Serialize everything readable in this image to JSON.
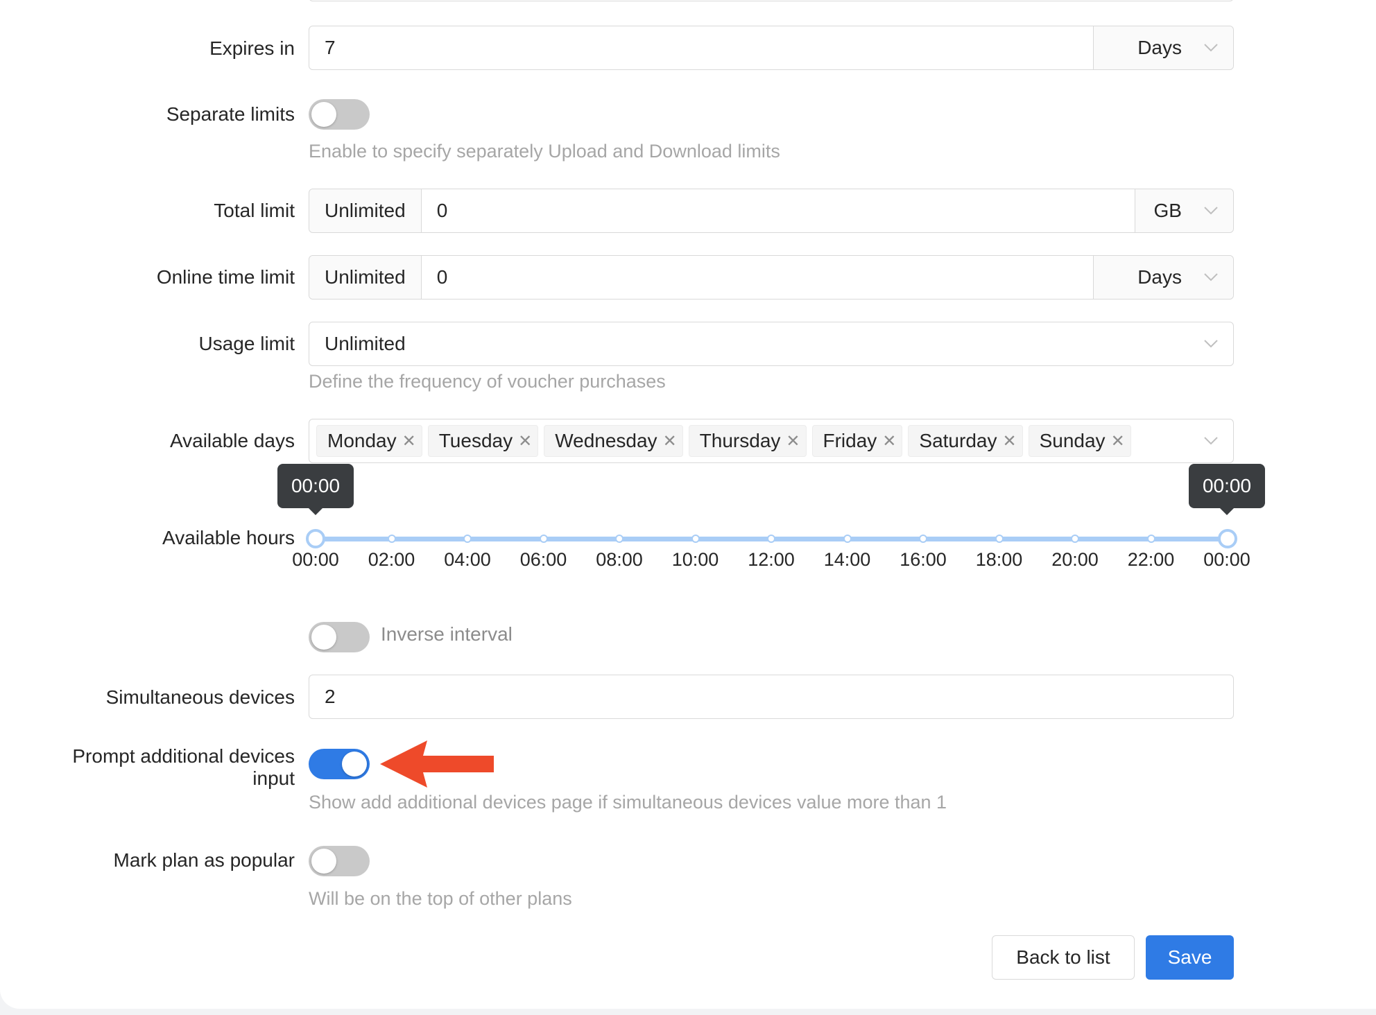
{
  "form": {
    "expires_in": {
      "label": "Expires in",
      "value": "7",
      "unit": "Days"
    },
    "separate_limits": {
      "label": "Separate limits",
      "enabled": false,
      "help": "Enable to specify separately Upload and Download limits"
    },
    "total_limit": {
      "label": "Total limit",
      "mode": "Unlimited",
      "value": "0",
      "unit": "GB"
    },
    "online_time_limit": {
      "label": "Online time limit",
      "mode": "Unlimited",
      "value": "0",
      "unit": "Days"
    },
    "usage_limit": {
      "label": "Usage limit",
      "value": "Unlimited",
      "help": "Define the frequency of voucher purchases"
    },
    "available_days": {
      "label": "Available days",
      "tags": [
        "Monday",
        "Tuesday",
        "Wednesday",
        "Thursday",
        "Friday",
        "Saturday",
        "Sunday"
      ]
    },
    "available_hours": {
      "label": "Available hours",
      "start_tooltip": "00:00",
      "end_tooltip": "00:00",
      "ticks": [
        "00:00",
        "02:00",
        "04:00",
        "06:00",
        "08:00",
        "10:00",
        "12:00",
        "14:00",
        "16:00",
        "18:00",
        "20:00",
        "22:00",
        "00:00"
      ]
    },
    "inverse_interval": {
      "label": "Inverse interval",
      "enabled": false
    },
    "simultaneous_devices": {
      "label": "Simultaneous devices",
      "value": "2"
    },
    "prompt_additional_devices": {
      "label_line1": "Prompt additional devices",
      "label_line2": "input",
      "enabled": true,
      "help": "Show add additional devices page if simultaneous devices value more than 1"
    },
    "mark_popular": {
      "label": "Mark plan as popular",
      "enabled": false,
      "help": "Will be on the top of other plans"
    }
  },
  "actions": {
    "back_label": "Back to list",
    "save_label": "Save"
  },
  "colors": {
    "primary": "#2f7be5",
    "arrow": "#ee4a2a",
    "slider": "#a9cdf6"
  }
}
